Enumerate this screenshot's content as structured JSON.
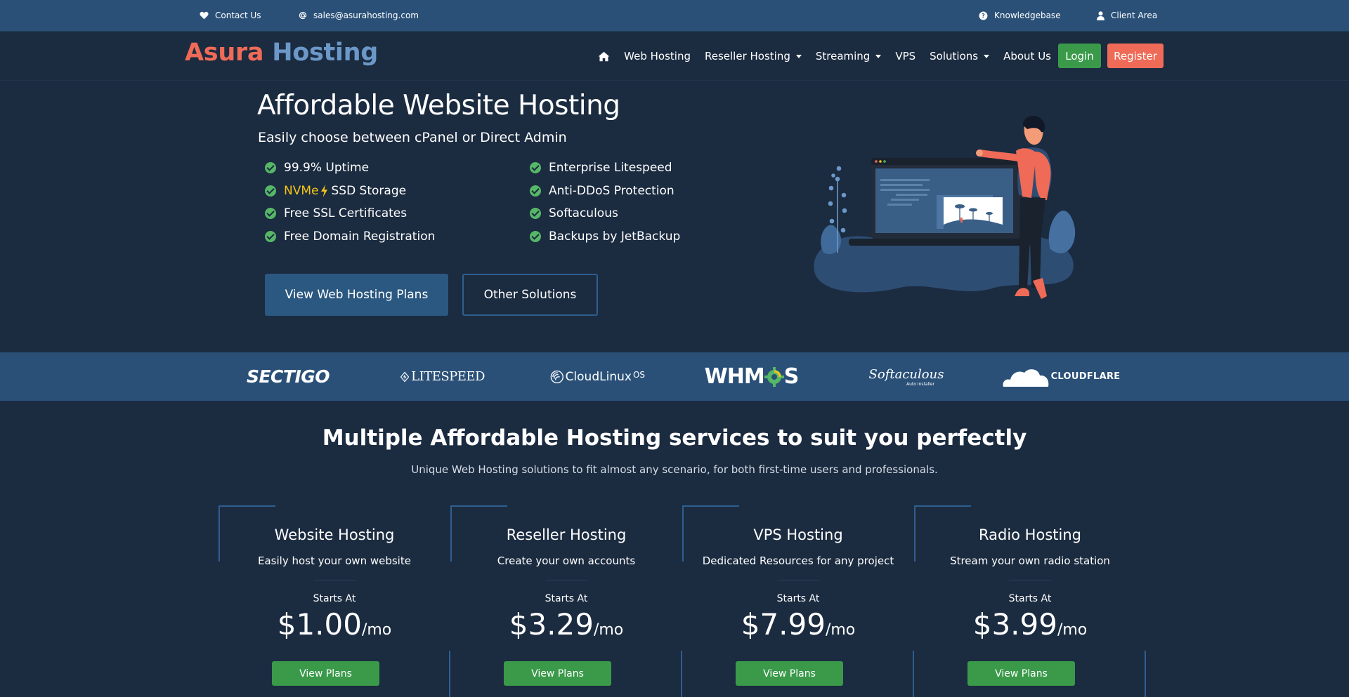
{
  "topbar": {
    "contact_us": "Contact Us",
    "email": "sales@asurahosting.com",
    "knowledgebase": "Knowledgebase",
    "client_area": "Client Area"
  },
  "logo": {
    "part1": "Asura",
    "part2": "Hosting"
  },
  "nav": {
    "items": [
      "Web Hosting",
      "Reseller Hosting",
      "Streaming",
      "VPS",
      "Solutions",
      "About Us"
    ],
    "login": "Login",
    "register": "Register"
  },
  "hero": {
    "title": "Affordable Website Hosting",
    "subtitle": "Easily choose between cPanel or Direct Admin",
    "features_left": [
      "99.9% Uptime",
      "NVMe",
      "SSD Storage",
      "Free SSL Certificates",
      "Free Domain Registration"
    ],
    "features_right": [
      "Enterprise Litespeed",
      "Anti-DDoS Protection",
      "Softaculous",
      "Backups by JetBackup"
    ],
    "btn_primary": "View Web Hosting Plans",
    "btn_secondary": "Other Solutions"
  },
  "partners": {
    "sectigo": "SECTIGO",
    "litespeed": "LITESPEED",
    "cloudlinux": "CloudLinux",
    "cloudlinux_os": "OS",
    "whmcs_a": "WHM",
    "whmcs_b": "S",
    "softaculous": "Softaculous",
    "softaculous_sub": "Auto Installer",
    "cloudflare": "CLOUDFLARE"
  },
  "services": {
    "title_pre": "Multiple",
    "title_bold": "Affordable",
    "title_post": "Hosting services to suit you perfectly",
    "subtitle": "Unique Web Hosting solutions to fit almost any scenario, for both first-time users and professionals.",
    "cards": [
      {
        "name": "Website Hosting",
        "desc": "Easily host your own website",
        "starts": "Starts At",
        "price": "$1.00",
        "unit": "/mo",
        "button": "View Plans"
      },
      {
        "name": "Reseller Hosting",
        "desc": "Create your own accounts",
        "starts": "Starts At",
        "price": "$3.29",
        "unit": "/mo",
        "button": "View Plans"
      },
      {
        "name": "VPS Hosting",
        "desc": "Dedicated Resources for any project",
        "starts": "Starts At",
        "price": "$7.99",
        "unit": "/mo",
        "button": "View Plans"
      },
      {
        "name": "Radio Hosting",
        "desc": "Stream your own radio station",
        "starts": "Starts At",
        "price": "$3.99",
        "unit": "/mo",
        "button": "View Plans"
      }
    ]
  },
  "colors": {
    "accent_red": "#ef6b57",
    "accent_blue": "#6b98c8",
    "green": "#3a9a4a",
    "bg": "#1b2b40",
    "bar": "#2a5078"
  }
}
